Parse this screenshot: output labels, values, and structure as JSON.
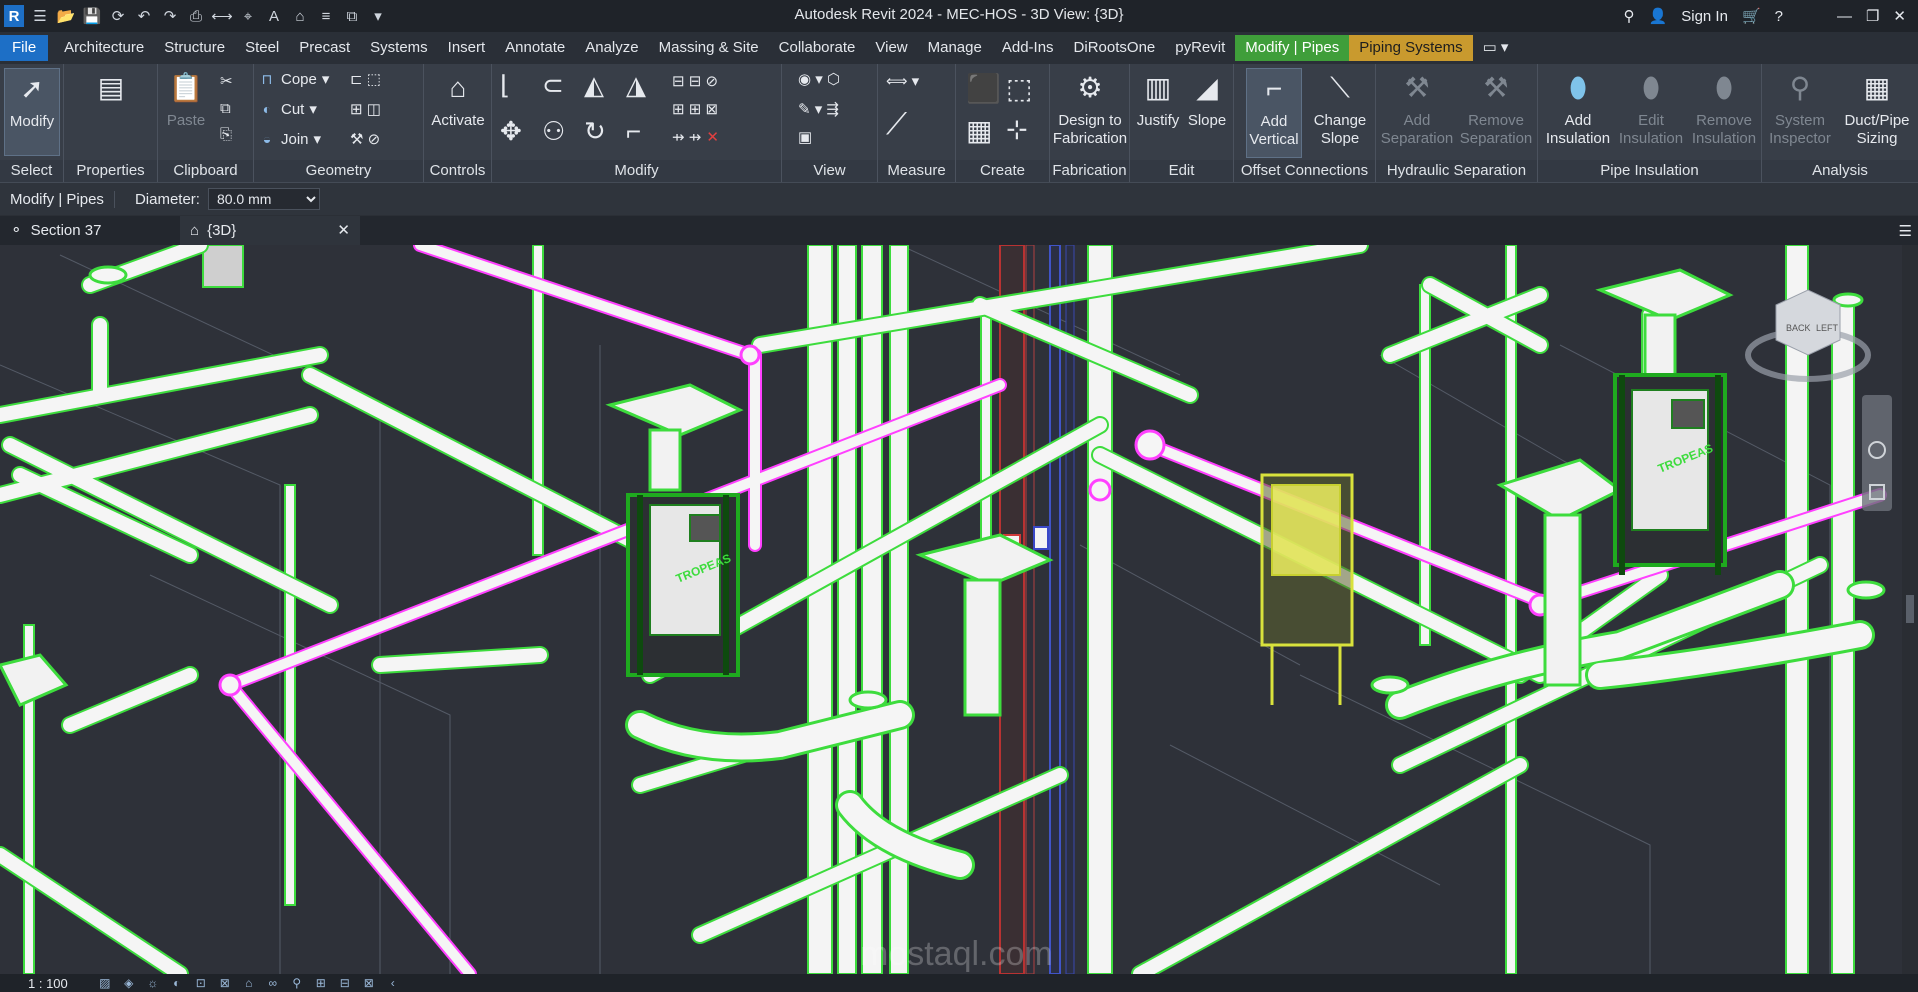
{
  "titlebar": {
    "app_logo": "R",
    "title": "Autodesk Revit 2024 - MEC-HOS - 3D View: {3D}",
    "sign_in": "Sign In",
    "quick_access_icons": [
      "open-icon",
      "save-icon",
      "sync-icon",
      "undo-icon",
      "redo-icon",
      "print-icon",
      "measure-icon",
      "tag-icon",
      "text-icon",
      "home-icon",
      "thin-lines-icon",
      "close-hidden-icon",
      "switch-windows-icon"
    ]
  },
  "tabs": [
    "File",
    "Architecture",
    "Structure",
    "Steel",
    "Precast",
    "Systems",
    "Insert",
    "Annotate",
    "Analyze",
    "Massing & Site",
    "Collaborate",
    "View",
    "Manage",
    "Add-Ins",
    "DiRootsOne",
    "pyRevit",
    "Modify | Pipes",
    "Piping Systems"
  ],
  "ribbon": {
    "select": {
      "button": "Modify",
      "label": "Select"
    },
    "properties": {
      "label": "Properties"
    },
    "clipboard": {
      "paste": "Paste",
      "label": "Clipboard"
    },
    "geometry": {
      "cope": "Cope",
      "cut": "Cut",
      "join": "Join",
      "label": "Geometry"
    },
    "controls": {
      "activate": "Activate",
      "label": "Controls"
    },
    "modify": {
      "label": "Modify"
    },
    "view": {
      "label": "View"
    },
    "measure": {
      "label": "Measure"
    },
    "create": {
      "label": "Create"
    },
    "fabrication": {
      "design": "Design to Fabrication",
      "label": "Fabrication"
    },
    "edit": {
      "justify": "Justify",
      "slope": "Slope",
      "label": "Edit"
    },
    "offset": {
      "add_vertical": "Add Vertical",
      "change_slope": "Change Slope",
      "label": "Offset Connections"
    },
    "hydraulic": {
      "add_sep": "Add Separation",
      "remove_sep": "Remove Separation",
      "label": "Hydraulic Separation"
    },
    "insulation": {
      "add": "Add Insulation",
      "edit": "Edit Insulation",
      "remove": "Remove Insulation",
      "label": "Pipe Insulation"
    },
    "analysis": {
      "inspector": "System Inspector",
      "sizing": "Duct/Pipe Sizing",
      "label": "Analysis"
    }
  },
  "optionsbar": {
    "context": "Modify | Pipes",
    "diameter_label": "Diameter:",
    "diameter_value": "80.0 mm"
  },
  "viewtabs": [
    {
      "label": "Section 37"
    },
    {
      "label": "{3D}"
    }
  ],
  "viewcube": {
    "faces": [
      "BACK",
      "LEFT"
    ]
  },
  "fixture_brand": [
    "TROPEAS"
  ],
  "watermark": "mostaql.com",
  "statusbar": {
    "scale": "1 : 100"
  },
  "colors": {
    "pipe_edge": "#3ddc3d",
    "selected": "#ff40ff",
    "highlight": "#e8f04a",
    "background": "#2e3139",
    "accent": "#1d6fc6"
  }
}
